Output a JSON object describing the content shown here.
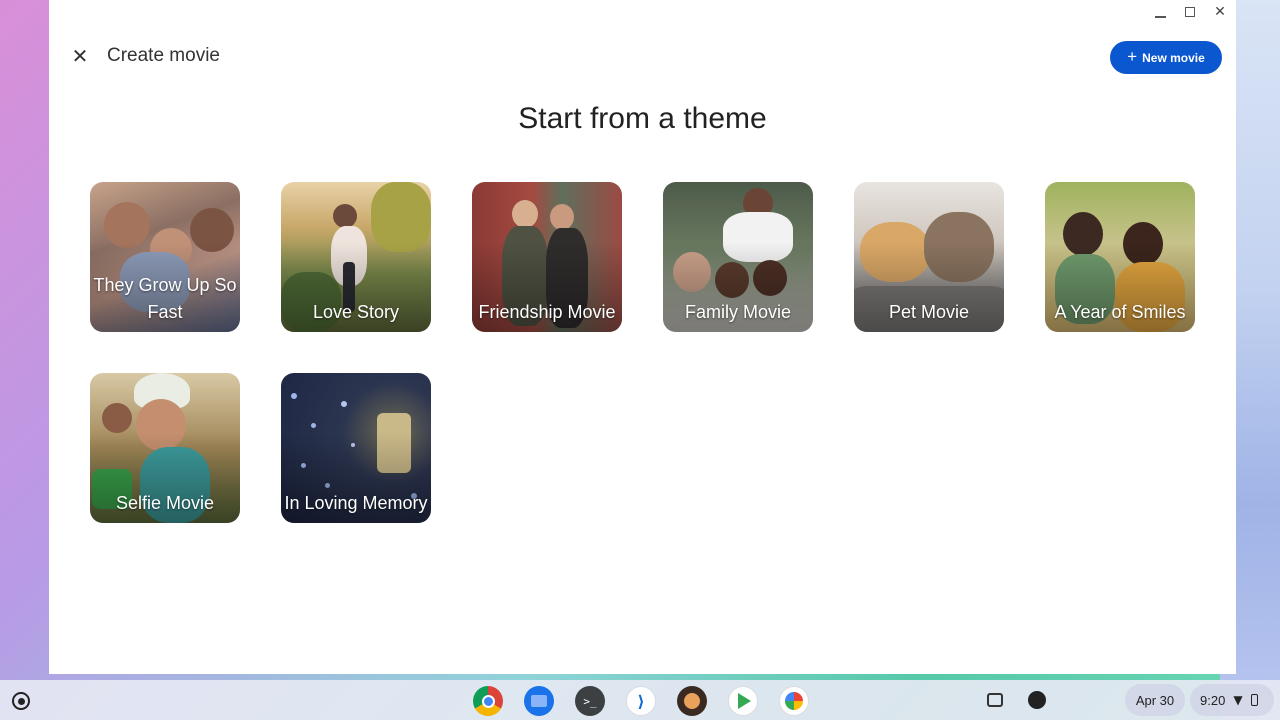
{
  "window": {
    "title": "Create movie",
    "new_movie_label": "New movie",
    "heading": "Start from a theme"
  },
  "themes": [
    {
      "label": "They Grow Up So Fast"
    },
    {
      "label": "Love Story"
    },
    {
      "label": "Friendship Movie"
    },
    {
      "label": "Family Movie"
    },
    {
      "label": "Pet Movie"
    },
    {
      "label": "A Year of Smiles"
    },
    {
      "label": "Selfie Movie"
    },
    {
      "label": "In Loving Memory"
    }
  ],
  "shelf": {
    "date": "Apr 30",
    "time": "9:20",
    "apps": [
      "chrome-icon",
      "files-icon",
      "terminal-icon",
      "vscode-icon",
      "app-icon",
      "play-store-icon",
      "photos-icon"
    ]
  },
  "colors": {
    "accent": "#0b57d0"
  }
}
